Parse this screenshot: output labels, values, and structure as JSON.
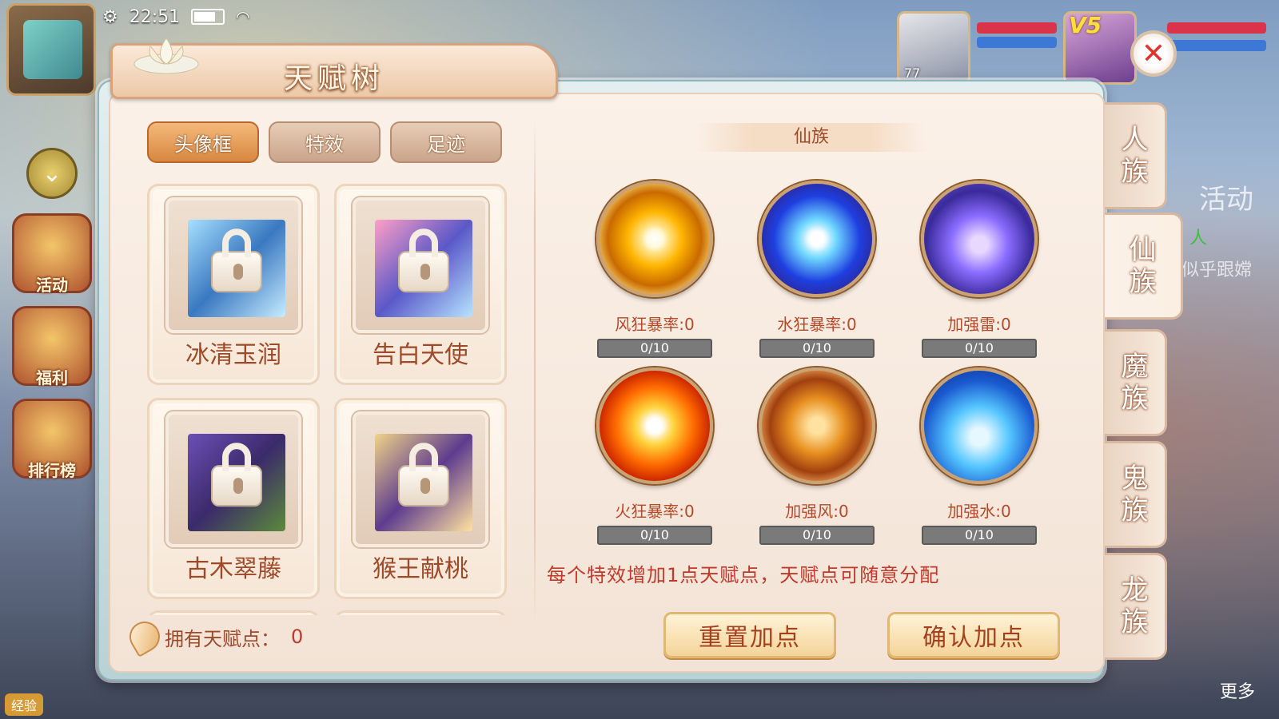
{
  "status": {
    "time": "22:51"
  },
  "hud": {
    "side_buttons": [
      "活动",
      "福利",
      "排行榜"
    ],
    "exp_label": "经验",
    "avatar1_level": "77",
    "avatar2_vip": "V5",
    "right_text_activity": "活动",
    "right_text_race": "人",
    "right_text_follow": "似乎跟嫦",
    "more_label": "更多"
  },
  "dialog": {
    "title": "天赋树",
    "close_symbol": "✕",
    "tabs": [
      {
        "label": "头像框",
        "active": true
      },
      {
        "label": "特效",
        "active": false
      },
      {
        "label": "足迹",
        "active": false
      }
    ],
    "frames": [
      {
        "name": "冰清玉润",
        "locked": true
      },
      {
        "name": "告白天使",
        "locked": true
      },
      {
        "name": "古木翠藤",
        "locked": true
      },
      {
        "name": "猴王献桃",
        "locked": true
      }
    ],
    "points_label": "拥有天赋点：",
    "points_value": "0",
    "race_header": "仙族",
    "skills": [
      {
        "label": "风狂暴率:0",
        "progress": "0/10",
        "icon": "wind-crit-orb-icon"
      },
      {
        "label": "水狂暴率:0",
        "progress": "0/10",
        "icon": "water-crit-orb-icon"
      },
      {
        "label": "加强雷:0",
        "progress": "0/10",
        "icon": "thunder-boost-orb-icon"
      },
      {
        "label": "火狂暴率:0",
        "progress": "0/10",
        "icon": "fire-crit-orb-icon"
      },
      {
        "label": "加强风:0",
        "progress": "0/10",
        "icon": "wind-boost-orb-icon"
      },
      {
        "label": "加强水:0",
        "progress": "0/10",
        "icon": "water-boost-orb-icon"
      }
    ],
    "hint": "每个特效增加1点天赋点，天赋点可随意分配",
    "reset_button": "重置加点",
    "confirm_button": "确认加点",
    "race_tabs": [
      {
        "line1": "人",
        "line2": "族",
        "active": false
      },
      {
        "line1": "仙",
        "line2": "族",
        "active": true
      },
      {
        "line1": "魔",
        "line2": "族",
        "active": false
      },
      {
        "line1": "鬼",
        "line2": "族",
        "active": false
      },
      {
        "line1": "龙",
        "line2": "族",
        "active": false
      }
    ]
  }
}
